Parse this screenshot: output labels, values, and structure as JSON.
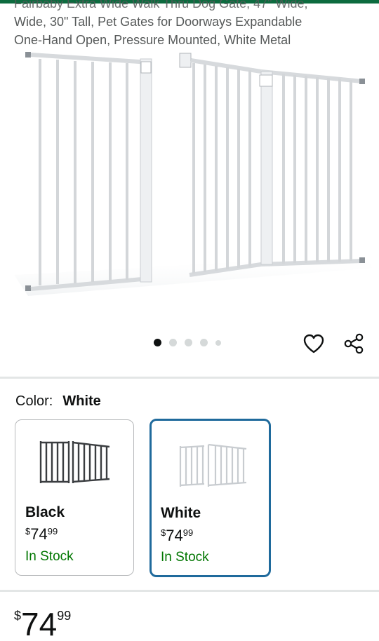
{
  "product": {
    "title_lines": [
      "Fairbaby Extra Wide Walk Thru Dog Gate, 47\" Wide,",
      "Wide, 30\" Tall, Pet Gates for Doorways Expandable",
      "One-Hand Open, Pressure Mounted, White Metal"
    ]
  },
  "gallery": {
    "image_count": 5,
    "active_index": 0
  },
  "actions": {
    "wishlist_icon": "heart-outline-icon",
    "share_icon": "share-icon"
  },
  "color_selector": {
    "label": "Color:",
    "selected": "White",
    "options": [
      {
        "name": "Black",
        "currency": "$",
        "dollars": "74",
        "cents": "99",
        "availability": "In Stock"
      },
      {
        "name": "White",
        "currency": "$",
        "dollars": "74",
        "cents": "99",
        "availability": "In Stock"
      }
    ]
  },
  "price": {
    "currency": "$",
    "dollars": "74",
    "cents": "99"
  },
  "colors": {
    "accent_green": "#0d6b3f",
    "selected_border": "#1f6a9c",
    "in_stock": "#007600"
  }
}
